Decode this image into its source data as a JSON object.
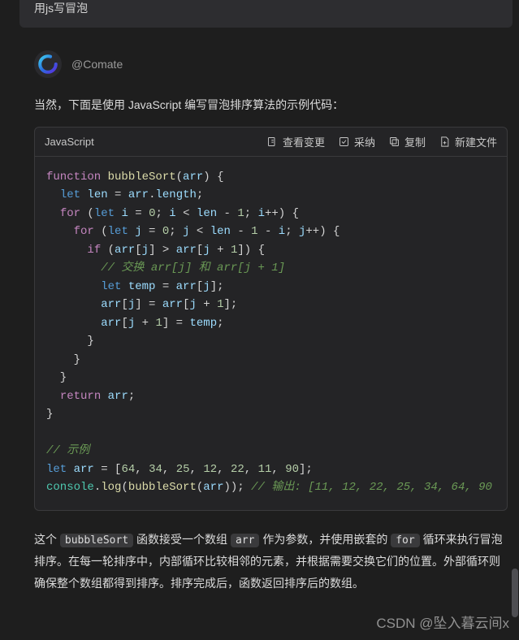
{
  "user_message": "用js写冒泡",
  "assistant": {
    "name": "@Comate",
    "intro": "当然，下面是使用 JavaScript 编写冒泡排序算法的示例代码："
  },
  "code_header": {
    "language": "JavaScript",
    "actions": {
      "view_changes": "查看变更",
      "accept": "采纳",
      "copy": "复制",
      "new_file": "新建文件"
    }
  },
  "code_lines": [
    [
      [
        "kw",
        "function "
      ],
      [
        "fn",
        "bubbleSort"
      ],
      [
        "punct",
        "("
      ],
      [
        "param",
        "arr"
      ],
      [
        "punct",
        ") {"
      ]
    ],
    [
      [
        "punct",
        "  "
      ],
      [
        "kw2",
        "let "
      ],
      [
        "var",
        "len"
      ],
      [
        "op",
        " = "
      ],
      [
        "var",
        "arr"
      ],
      [
        "punct",
        "."
      ],
      [
        "prop",
        "length"
      ],
      [
        "punct",
        ";"
      ]
    ],
    [
      [
        "punct",
        "  "
      ],
      [
        "kw",
        "for"
      ],
      [
        "punct",
        " ("
      ],
      [
        "kw2",
        "let "
      ],
      [
        "var",
        "i"
      ],
      [
        "op",
        " = "
      ],
      [
        "num",
        "0"
      ],
      [
        "punct",
        "; "
      ],
      [
        "var",
        "i"
      ],
      [
        "op",
        " < "
      ],
      [
        "var",
        "len"
      ],
      [
        "op",
        " - "
      ],
      [
        "num",
        "1"
      ],
      [
        "punct",
        "; "
      ],
      [
        "var",
        "i"
      ],
      [
        "op",
        "++"
      ],
      [
        "punct",
        ") {"
      ]
    ],
    [
      [
        "punct",
        "    "
      ],
      [
        "kw",
        "for"
      ],
      [
        "punct",
        " ("
      ],
      [
        "kw2",
        "let "
      ],
      [
        "var",
        "j"
      ],
      [
        "op",
        " = "
      ],
      [
        "num",
        "0"
      ],
      [
        "punct",
        "; "
      ],
      [
        "var",
        "j"
      ],
      [
        "op",
        " < "
      ],
      [
        "var",
        "len"
      ],
      [
        "op",
        " - "
      ],
      [
        "num",
        "1"
      ],
      [
        "op",
        " - "
      ],
      [
        "var",
        "i"
      ],
      [
        "punct",
        "; "
      ],
      [
        "var",
        "j"
      ],
      [
        "op",
        "++"
      ],
      [
        "punct",
        ") {"
      ]
    ],
    [
      [
        "punct",
        "      "
      ],
      [
        "kw",
        "if"
      ],
      [
        "punct",
        " ("
      ],
      [
        "var",
        "arr"
      ],
      [
        "punct",
        "["
      ],
      [
        "var",
        "j"
      ],
      [
        "punct",
        "]"
      ],
      [
        "op",
        " > "
      ],
      [
        "var",
        "arr"
      ],
      [
        "punct",
        "["
      ],
      [
        "var",
        "j"
      ],
      [
        "op",
        " + "
      ],
      [
        "num",
        "1"
      ],
      [
        "punct",
        "]) {"
      ]
    ],
    [
      [
        "punct",
        "        "
      ],
      [
        "cmt",
        "// 交换 arr[j] 和 arr[j + 1]"
      ]
    ],
    [
      [
        "punct",
        "        "
      ],
      [
        "kw2",
        "let "
      ],
      [
        "var",
        "temp"
      ],
      [
        "op",
        " = "
      ],
      [
        "var",
        "arr"
      ],
      [
        "punct",
        "["
      ],
      [
        "var",
        "j"
      ],
      [
        "punct",
        "];"
      ]
    ],
    [
      [
        "punct",
        "        "
      ],
      [
        "var",
        "arr"
      ],
      [
        "punct",
        "["
      ],
      [
        "var",
        "j"
      ],
      [
        "punct",
        "]"
      ],
      [
        "op",
        " = "
      ],
      [
        "var",
        "arr"
      ],
      [
        "punct",
        "["
      ],
      [
        "var",
        "j"
      ],
      [
        "op",
        " + "
      ],
      [
        "num",
        "1"
      ],
      [
        "punct",
        "];"
      ]
    ],
    [
      [
        "punct",
        "        "
      ],
      [
        "var",
        "arr"
      ],
      [
        "punct",
        "["
      ],
      [
        "var",
        "j"
      ],
      [
        "op",
        " + "
      ],
      [
        "num",
        "1"
      ],
      [
        "punct",
        "]"
      ],
      [
        "op",
        " = "
      ],
      [
        "var",
        "temp"
      ],
      [
        "punct",
        ";"
      ]
    ],
    [
      [
        "punct",
        "      }"
      ]
    ],
    [
      [
        "punct",
        "    }"
      ]
    ],
    [
      [
        "punct",
        "  }"
      ]
    ],
    [
      [
        "punct",
        "  "
      ],
      [
        "kw",
        "return"
      ],
      [
        "punct",
        " "
      ],
      [
        "var",
        "arr"
      ],
      [
        "punct",
        ";"
      ]
    ],
    [
      [
        "punct",
        "}"
      ]
    ],
    [
      [
        "punct",
        ""
      ]
    ],
    [
      [
        "cmt",
        "// 示例"
      ]
    ],
    [
      [
        "kw2",
        "let "
      ],
      [
        "var",
        "arr"
      ],
      [
        "op",
        " = "
      ],
      [
        "punct",
        "["
      ],
      [
        "num",
        "64"
      ],
      [
        "punct",
        ", "
      ],
      [
        "num",
        "34"
      ],
      [
        "punct",
        ", "
      ],
      [
        "num",
        "25"
      ],
      [
        "punct",
        ", "
      ],
      [
        "num",
        "12"
      ],
      [
        "punct",
        ", "
      ],
      [
        "num",
        "22"
      ],
      [
        "punct",
        ", "
      ],
      [
        "num",
        "11"
      ],
      [
        "punct",
        ", "
      ],
      [
        "num",
        "90"
      ],
      [
        "punct",
        "];"
      ]
    ],
    [
      [
        "obj",
        "console"
      ],
      [
        "punct",
        "."
      ],
      [
        "fn",
        "log"
      ],
      [
        "punct",
        "("
      ],
      [
        "fn",
        "bubbleSort"
      ],
      [
        "punct",
        "("
      ],
      [
        "var",
        "arr"
      ],
      [
        "punct",
        "));"
      ],
      [
        "punct",
        " "
      ],
      [
        "cmt",
        "// 输出: [11, 12, 22, 25, 34, 64, 90"
      ]
    ]
  ],
  "description": {
    "p1a": "这个 ",
    "c1": "bubbleSort",
    "p1b": " 函数接受一个数组 ",
    "c2": "arr",
    "p1c": " 作为参数，并使用嵌套的 ",
    "c3": "for",
    "p1d": " 循环来执行冒泡排序。在每一轮排序中，内部循环比较相邻的元素，并根据需要交换它们的位置。外部循环则确保整个数组都得到排序。排序完成后，函数返回排序后的数组。"
  },
  "watermark": "CSDN @坠入暮云间x"
}
